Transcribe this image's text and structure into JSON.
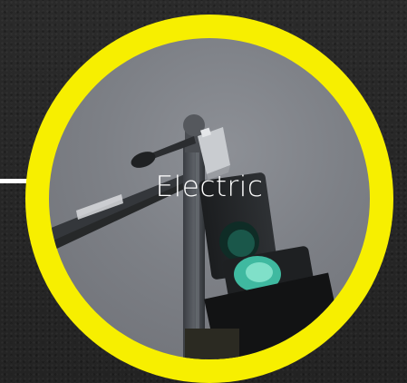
{
  "badge": {
    "label": "Electric",
    "ring_color": "#f7ef00",
    "background_color": "#262626",
    "photo_subject": "traffic-light-and-street-pole-photo"
  }
}
